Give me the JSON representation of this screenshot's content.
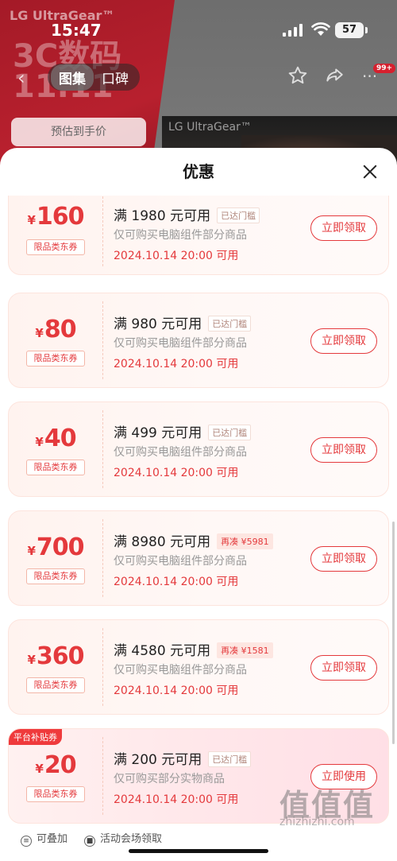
{
  "status_bar": {
    "time": "15:47",
    "battery": "57"
  },
  "background": {
    "brand": "LG UltraGear™",
    "promo": "3C数码 11.11",
    "tabs": [
      "图集",
      "口碑"
    ],
    "estimate": "预估到手价",
    "monitor_label": "LG UltraGear™",
    "badge": "99+"
  },
  "sheet": {
    "title": "优惠"
  },
  "coupons": [
    {
      "currency": "¥",
      "amount": "160",
      "tag": "限品类东券",
      "condition": "满 1980 元可用",
      "status": "已达门槛",
      "scope": "仅可购买电脑组件部分商品",
      "date": "2024.10.14 20:00 可用",
      "button": "立即领取"
    },
    {
      "currency": "¥",
      "amount": "80",
      "tag": "限品类东券",
      "condition": "满 980 元可用",
      "status": "已达门槛",
      "scope": "仅可购买电脑组件部分商品",
      "date": "2024.10.14 20:00 可用",
      "button": "立即领取"
    },
    {
      "currency": "¥",
      "amount": "40",
      "tag": "限品类东券",
      "condition": "满 499 元可用",
      "status": "已达门槛",
      "scope": "仅可购买电脑组件部分商品",
      "date": "2024.10.14 20:00 可用",
      "button": "立即领取"
    },
    {
      "currency": "¥",
      "amount": "700",
      "tag": "限品类东券",
      "condition": "满 8980 元可用",
      "status": "再凑 ¥5981",
      "scope": "仅可购买电脑组件部分商品",
      "date": "2024.10.14 20:00 可用",
      "button": "立即领取"
    },
    {
      "currency": "¥",
      "amount": "360",
      "tag": "限品类东券",
      "condition": "满 4580 元可用",
      "status": "再凑 ¥1581",
      "scope": "仅可购买电脑组件部分商品",
      "date": "2024.10.14 20:00 可用",
      "button": "立即领取"
    },
    {
      "currency": "¥",
      "amount": "20",
      "tag": "限品类东券",
      "condition": "满 200 元可用",
      "status": "已达门槛",
      "scope": "仅可购买部分实物商品",
      "date": "2024.10.14 20:00 可用",
      "button": "立即使用",
      "badge": "平台补贴券"
    }
  ],
  "footer": {
    "stackable": "可叠加",
    "venue": "活动会场领取"
  },
  "watermark": {
    "text": "值值值",
    "url": "zhizhizhi.com"
  },
  "colors": {
    "accent": "#e4393c",
    "coupon_bg": "#fff3ef"
  }
}
